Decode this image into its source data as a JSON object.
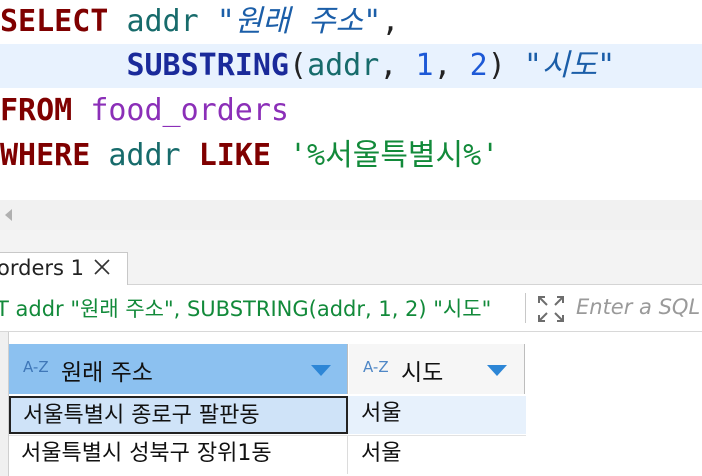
{
  "editor": {
    "line1": {
      "kw": "SELECT",
      "id": "addr",
      "str": "\"원래 주소\"",
      "punct": ","
    },
    "line2": {
      "fn": "SUBSTRING",
      "open": "(",
      "id": "addr",
      "comma1": ",",
      "n1": "1",
      "comma2": ",",
      "n2": "2",
      "close": ")",
      "str": "\"시도\""
    },
    "line3": {
      "kw": "FROM",
      "table": "food_orders"
    },
    "line4": {
      "kw": "WHERE",
      "id": "addr",
      "op": "LIKE",
      "literal": "'%서울특별시%'"
    }
  },
  "results": {
    "tab_label": "orders 1",
    "filter_query": "T addr \"원래 주소\", SUBSTRING(addr, 1, 2) \"시도\"",
    "sql_filter_placeholder": "Enter a SQL",
    "columns": [
      {
        "type_badge": "A-Z",
        "label": "원래 주소"
      },
      {
        "type_badge": "A-Z",
        "label": "시도"
      }
    ],
    "rows": [
      [
        "서울특별시 종로구 팔판동",
        "서울"
      ],
      [
        "서울특별시 성북구 장위1동",
        "서울"
      ]
    ]
  },
  "colors": {
    "keyword": "#7f0000",
    "identifier": "#176b6b",
    "string": "#1b5ea8",
    "literal": "#128a3a",
    "selected_header": "#8cc1f0"
  }
}
